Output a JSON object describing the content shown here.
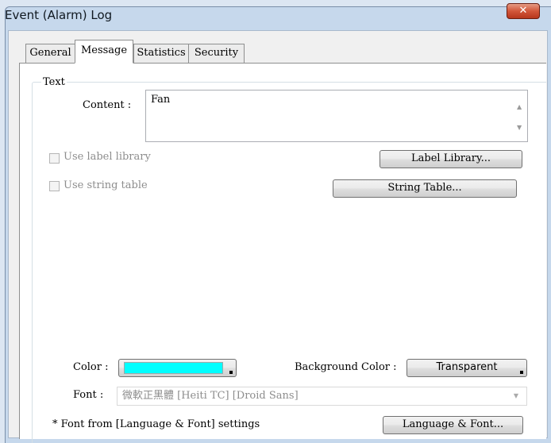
{
  "window": {
    "title": "Event (Alarm) Log",
    "close_glyph": "✕"
  },
  "tabs": [
    {
      "label": "General",
      "active": false
    },
    {
      "label": "Message",
      "active": true
    },
    {
      "label": "Statistics",
      "active": false
    },
    {
      "label": "Security",
      "active": false
    }
  ],
  "text_group": {
    "label": "Text",
    "content_label": "Content :",
    "content_value": "Fan",
    "use_label_library": {
      "label": "Use label library",
      "checked": false,
      "enabled": false
    },
    "use_string_table": {
      "label": "Use string table",
      "checked": false,
      "enabled": false
    },
    "label_library_button": "Label Library...",
    "string_table_button": "String Table...",
    "color_label": "Color :",
    "color_value": "#00ffff",
    "background_color_label": "Background Color :",
    "background_color_value": "Transparent",
    "font_label": "Font :",
    "font_value": "微軟正黑體 [Heiti TC] [Droid Sans]",
    "font_note": "* Font from [Language & Font] settings",
    "language_font_button": "Language & Font..."
  },
  "scroll_icons": {
    "up": "▲",
    "down": "▼"
  }
}
